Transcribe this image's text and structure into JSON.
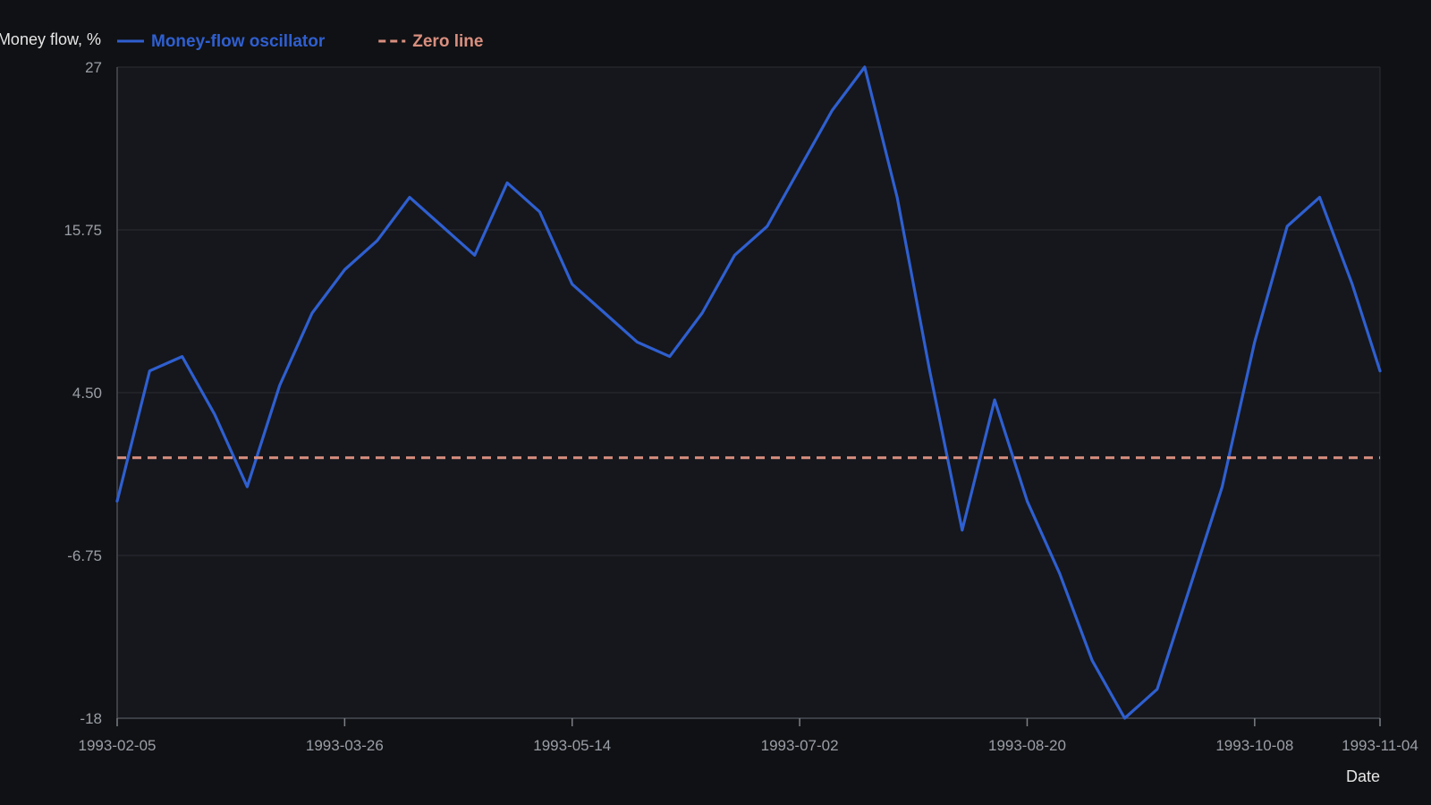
{
  "chart_data": {
    "type": "line",
    "xlabel": "Date",
    "ylabel": "Money flow, %",
    "ylim": [
      -18,
      27
    ],
    "yticks": [
      "27",
      "15.75",
      "4.50",
      "-6.75",
      "-18"
    ],
    "xlim": [
      "1993-02-05",
      "1993-11-04"
    ],
    "xticks": [
      "1993-02-05",
      "1993-03-26",
      "1993-05-14",
      "1993-07-02",
      "1993-08-20",
      "1993-10-08",
      "1993-11-04"
    ],
    "grid": true,
    "legend_position": "top-left",
    "series": [
      {
        "name": "Money-flow oscillator",
        "color": "#2f5fd0",
        "style": "solid",
        "points": [
          [
            "1993-02-05",
            -3.0
          ],
          [
            "1993-02-12",
            6.0
          ],
          [
            "1993-02-19",
            7.0
          ],
          [
            "1993-02-26",
            3.0
          ],
          [
            "1993-03-05",
            -2.0
          ],
          [
            "1993-03-12",
            5.0
          ],
          [
            "1993-03-19",
            10.0
          ],
          [
            "1993-03-26",
            13.0
          ],
          [
            "1993-04-02",
            15.0
          ],
          [
            "1993-04-09",
            18.0
          ],
          [
            "1993-04-16",
            16.0
          ],
          [
            "1993-04-23",
            14.0
          ],
          [
            "1993-04-30",
            19.0
          ],
          [
            "1993-05-07",
            17.0
          ],
          [
            "1993-05-14",
            12.0
          ],
          [
            "1993-05-21",
            10.0
          ],
          [
            "1993-05-28",
            8.0
          ],
          [
            "1993-06-04",
            7.0
          ],
          [
            "1993-06-11",
            10.0
          ],
          [
            "1993-06-18",
            14.0
          ],
          [
            "1993-06-25",
            16.0
          ],
          [
            "1993-07-02",
            20.0
          ],
          [
            "1993-07-09",
            24.0
          ],
          [
            "1993-07-16",
            27.0
          ],
          [
            "1993-07-23",
            18.0
          ],
          [
            "1993-07-30",
            6.0
          ],
          [
            "1993-08-06",
            -5.0
          ],
          [
            "1993-08-13",
            4.0
          ],
          [
            "1993-08-20",
            -3.0
          ],
          [
            "1993-08-27",
            -8.0
          ],
          [
            "1993-09-03",
            -14.0
          ],
          [
            "1993-09-10",
            -18.0
          ],
          [
            "1993-09-17",
            -16.0
          ],
          [
            "1993-09-24",
            -9.0
          ],
          [
            "1993-10-01",
            -2.0
          ],
          [
            "1993-10-08",
            8.0
          ],
          [
            "1993-10-15",
            16.0
          ],
          [
            "1993-10-22",
            18.0
          ],
          [
            "1993-10-29",
            12.0
          ],
          [
            "1993-11-04",
            6.0
          ]
        ]
      },
      {
        "name": "Zero line",
        "color": "#d98f7f",
        "style": "dashed",
        "points": [
          [
            "1993-02-05",
            0
          ],
          [
            "1993-11-04",
            0
          ]
        ]
      }
    ]
  }
}
